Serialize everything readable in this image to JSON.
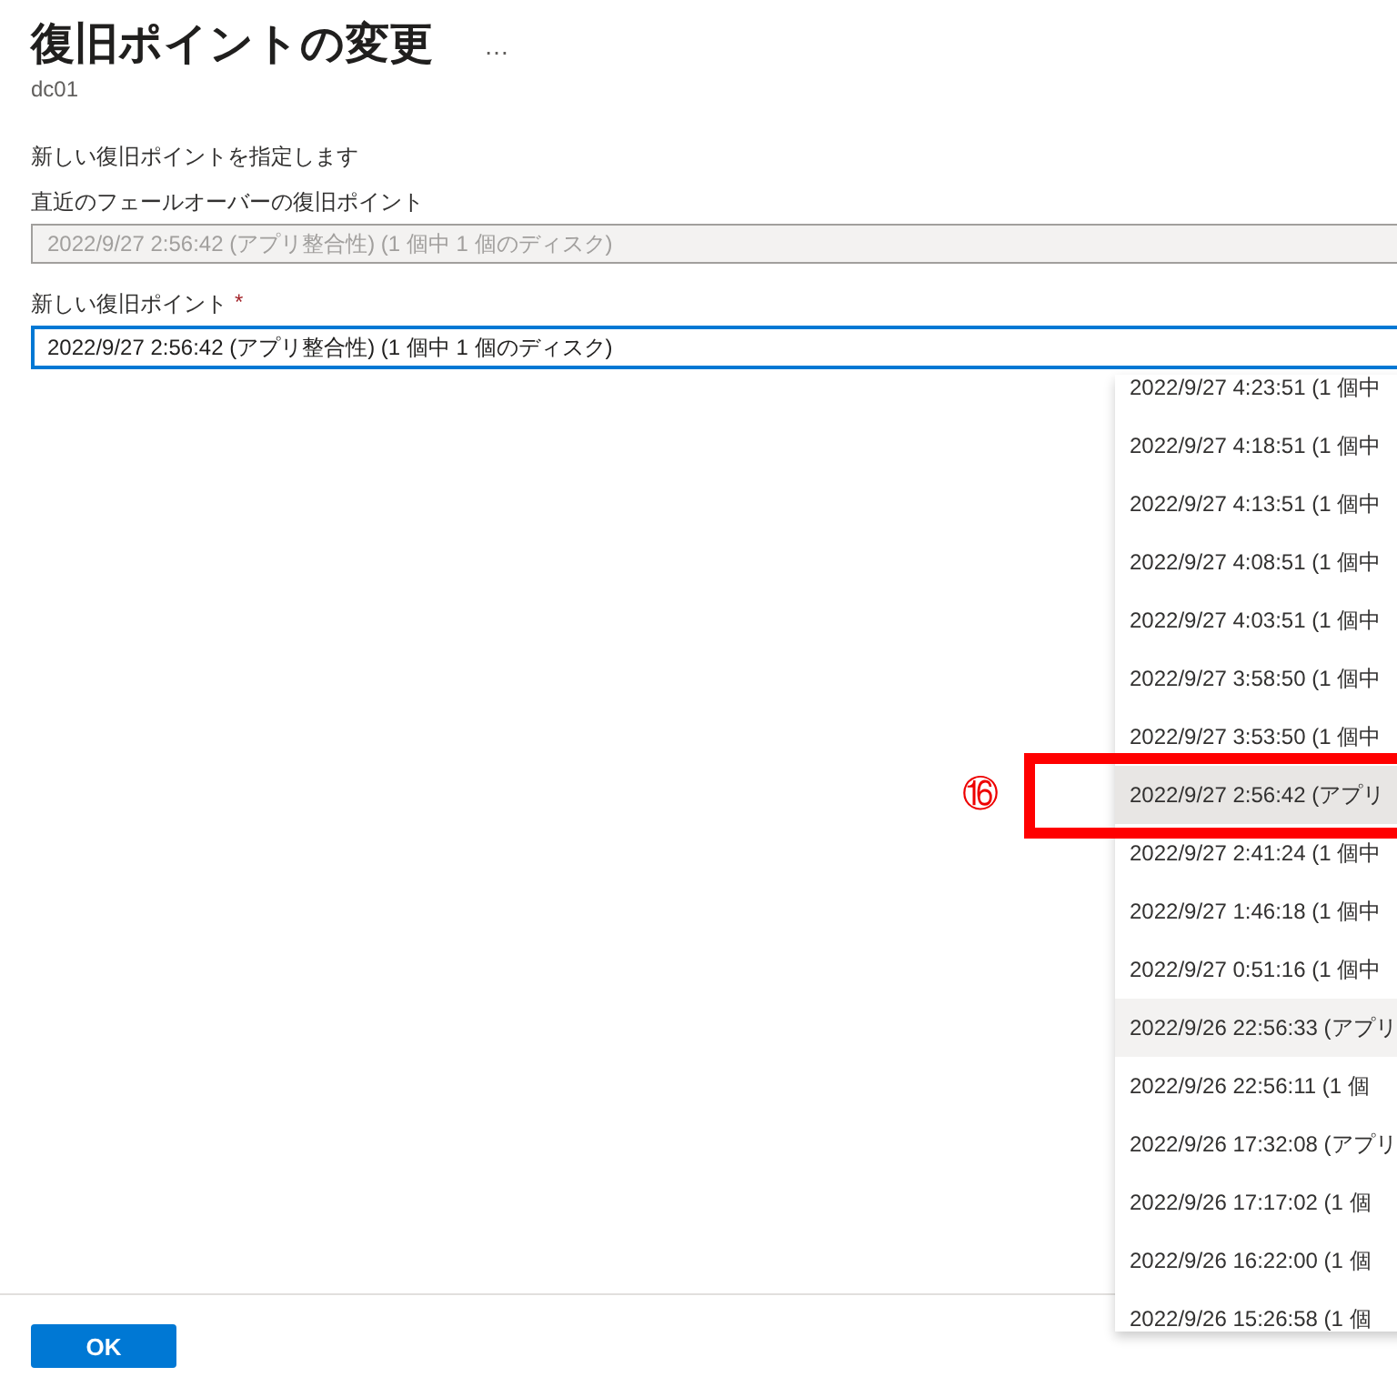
{
  "header": {
    "title": "復旧ポイントの変更",
    "more_icon": "…",
    "subtitle": "dc01"
  },
  "instruction": "新しい復旧ポイントを指定します",
  "latest_field": {
    "label": "直近のフェールオーバーの復旧ポイント",
    "value": "2022/9/27 2:56:42 (アプリ整合性) (1 個中 1 個のディスク)",
    "disabled": true
  },
  "new_field": {
    "label": "新しい復旧ポイント",
    "required_mark": "*",
    "value": "2022/9/27 2:56:42 (アプリ整合性) (1 個中 1 個のディスク)",
    "disabled": false
  },
  "dropdown_options": [
    {
      "text": "2022/9/27 4:23:51 (1 個中",
      "selected": false,
      "hovered": false
    },
    {
      "text": "2022/9/27 4:18:51 (1 個中",
      "selected": false,
      "hovered": false
    },
    {
      "text": "2022/9/27 4:13:51 (1 個中",
      "selected": false,
      "hovered": false
    },
    {
      "text": "2022/9/27 4:08:51 (1 個中",
      "selected": false,
      "hovered": false
    },
    {
      "text": "2022/9/27 4:03:51 (1 個中",
      "selected": false,
      "hovered": false
    },
    {
      "text": "2022/9/27 3:58:50 (1 個中",
      "selected": false,
      "hovered": false
    },
    {
      "text": "2022/9/27 3:53:50 (1 個中",
      "selected": false,
      "hovered": false
    },
    {
      "text": "2022/9/27 2:56:42 (アプリ",
      "selected": true,
      "hovered": false
    },
    {
      "text": "2022/9/27 2:41:24 (1 個中",
      "selected": false,
      "hovered": false
    },
    {
      "text": "2022/9/27 1:46:18 (1 個中",
      "selected": false,
      "hovered": false
    },
    {
      "text": "2022/9/27 0:51:16 (1 個中",
      "selected": false,
      "hovered": false
    },
    {
      "text": "2022/9/26 22:56:33 (アプリ",
      "selected": false,
      "hovered": true
    },
    {
      "text": "2022/9/26 22:56:11 (1 個",
      "selected": false,
      "hovered": false
    },
    {
      "text": "2022/9/26 17:32:08 (アプリ",
      "selected": false,
      "hovered": false
    },
    {
      "text": "2022/9/26 17:17:02 (1 個",
      "selected": false,
      "hovered": false
    },
    {
      "text": "2022/9/26 16:22:00 (1 個",
      "selected": false,
      "hovered": false
    },
    {
      "text": "2022/9/26 15:26:58 (1 個",
      "selected": false,
      "hovered": false
    }
  ],
  "annotation": {
    "label": "⑯"
  },
  "footer": {
    "ok_button": "OK"
  }
}
